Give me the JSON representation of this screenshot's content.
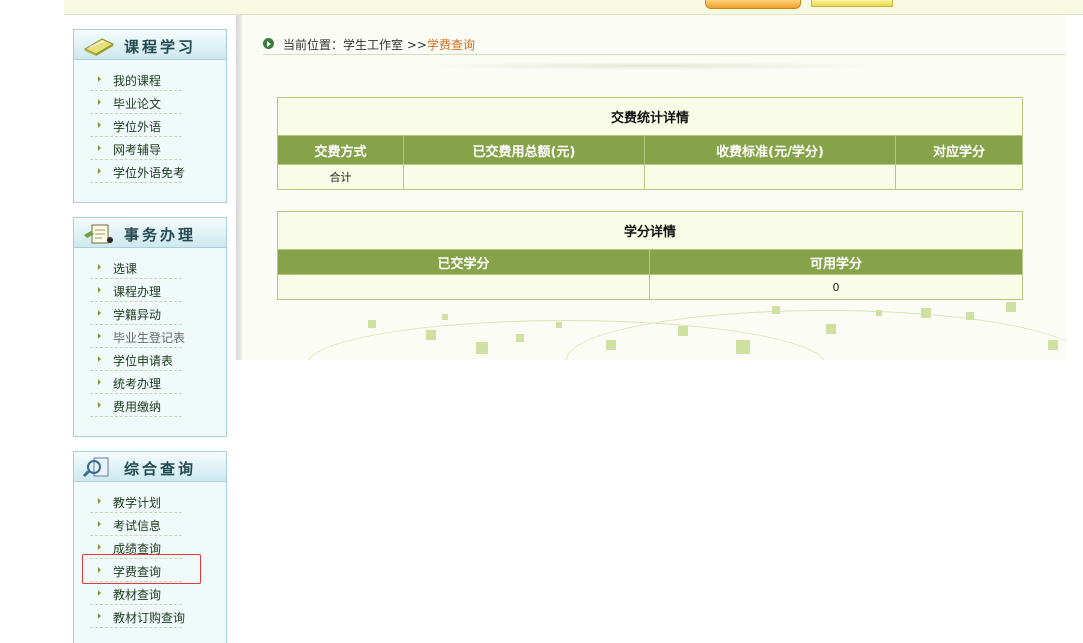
{
  "sidebar": {
    "course": {
      "title": "课程学习",
      "items": [
        {
          "label": "我的课程"
        },
        {
          "label": "毕业论文"
        },
        {
          "label": "学位外语"
        },
        {
          "label": "网考辅导"
        },
        {
          "label": "学位外语免考"
        }
      ]
    },
    "affairs": {
      "title": "事务办理",
      "items": [
        {
          "label": "选课"
        },
        {
          "label": "课程办理"
        },
        {
          "label": "学籍异动"
        },
        {
          "label": "毕业生登记表"
        },
        {
          "label": "学位申请表"
        },
        {
          "label": "统考办理"
        },
        {
          "label": "费用缴纳"
        }
      ]
    },
    "query": {
      "title": "综合查询",
      "items": [
        {
          "label": "教学计划"
        },
        {
          "label": "考试信息"
        },
        {
          "label": "成绩查询"
        },
        {
          "label": "学费查询"
        },
        {
          "label": "教材查询"
        },
        {
          "label": "教材订购查询"
        }
      ]
    }
  },
  "breadcrumb": {
    "prefix": "当前位置：学生工作室 >>",
    "current": "学费查询"
  },
  "fee_table": {
    "caption": "交费统计详情",
    "headers": [
      "交费方式",
      "已交费用总额(元)",
      "收费标准(元/学分)",
      "对应学分"
    ],
    "rows": [
      [
        "合计",
        "",
        "",
        ""
      ]
    ]
  },
  "credit_table": {
    "caption": "学分详情",
    "headers": [
      "已交学分",
      "可用学分"
    ],
    "rows": [
      [
        "",
        "0"
      ]
    ]
  },
  "colors": {
    "header_green": "#86a34a",
    "breadcrumb_current": "#d36f1a",
    "highlight_border": "#e23b3b"
  }
}
